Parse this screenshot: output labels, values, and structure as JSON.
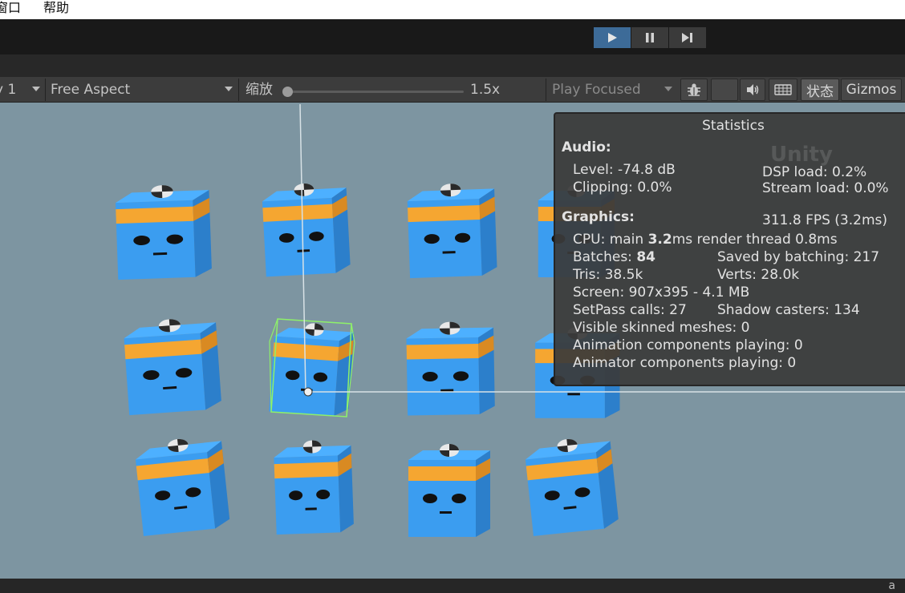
{
  "menu": {
    "items": [
      {
        "label": "窗口"
      },
      {
        "label": "帮助"
      }
    ]
  },
  "toolbar": {
    "play": {
      "icon": "play-icon",
      "active": true
    },
    "pause": {
      "icon": "pause-icon"
    },
    "step": {
      "icon": "step-icon"
    }
  },
  "game_bar": {
    "display": "y 1",
    "aspect": "Free Aspect",
    "scale_label": "缩放",
    "scale_value": "1.5x",
    "play_mode": "Play Focused",
    "stats_label": "状态",
    "gizmos_label": "Gizmos",
    "icons": [
      "bug-icon",
      "audio-icon",
      "keyboard-icon"
    ]
  },
  "statistics": {
    "title": "Statistics",
    "brand": "Unity",
    "audio": {
      "heading": "Audio:",
      "level": "Level: -74.8 dB",
      "clipping": "Clipping: 0.0%",
      "dsp_load": "DSP load: 0.2%",
      "stream_load": "Stream load: 0.0%"
    },
    "graphics": {
      "heading": "Graphics:",
      "fps": "311.8 FPS (3.2ms)",
      "cpu_prefix": "CPU: main ",
      "cpu_main": "3.2",
      "cpu_suffix": "ms  render thread 0.8ms",
      "batches_prefix": "Batches: ",
      "batches": "84",
      "saved_batching": "Saved by batching: 217",
      "tris": "Tris: 38.5k",
      "verts": "Verts: 28.0k",
      "screen": "Screen: 907x395 - 4.1 MB",
      "setpass": "SetPass calls: 27",
      "shadow_casters": "Shadow casters: 134",
      "skinned": "Visible skinned meshes: 0",
      "animation": "Animation components playing: 0",
      "animator": "Animator components playing: 0"
    }
  },
  "bottom_bar": {
    "label": "a"
  },
  "colors": {
    "viewport_bg": "#7d95a1",
    "cube_blue": "#3b9df0",
    "cube_side": "#2d80cc",
    "stripe": "#f5a631",
    "stripe_side": "#d98a22",
    "selection": "#8ef06a",
    "play_active": "#3d6b98"
  },
  "scene": {
    "cube_count": 15,
    "selected_cube": 5
  }
}
